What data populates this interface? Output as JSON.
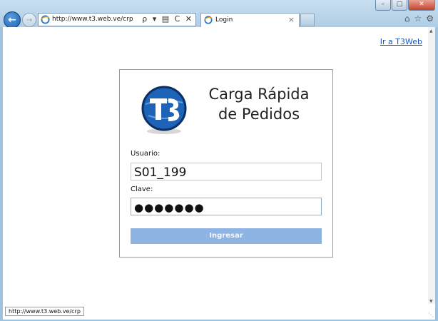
{
  "browser": {
    "address_url": "http://www.t3.web.ve/crp",
    "address_tools": "ρ ▾ ▤ C ✕",
    "tab_title": "Login",
    "tab_close": "×",
    "window_controls": {
      "minimize": "–",
      "maximize": "□",
      "close": "✕"
    },
    "right_icons": [
      "home-icon",
      "star-icon",
      "gear-icon"
    ],
    "status_url": "http://www.t3.web.ve/crp"
  },
  "page": {
    "link_t3web": "Ir a T3Web",
    "title_line1": "Carga Rápida",
    "title_line2": "de Pedidos",
    "logo_icon": "t3-logo-icon",
    "usuario_label": "Usuario:",
    "usuario_value": "S01_199",
    "clave_label": "Clave:",
    "clave_value": "●●●●●●●",
    "submit_label": "Ingresar"
  },
  "colors": {
    "submit_bg": "#8eb4e4",
    "link": "#1a56b8"
  }
}
